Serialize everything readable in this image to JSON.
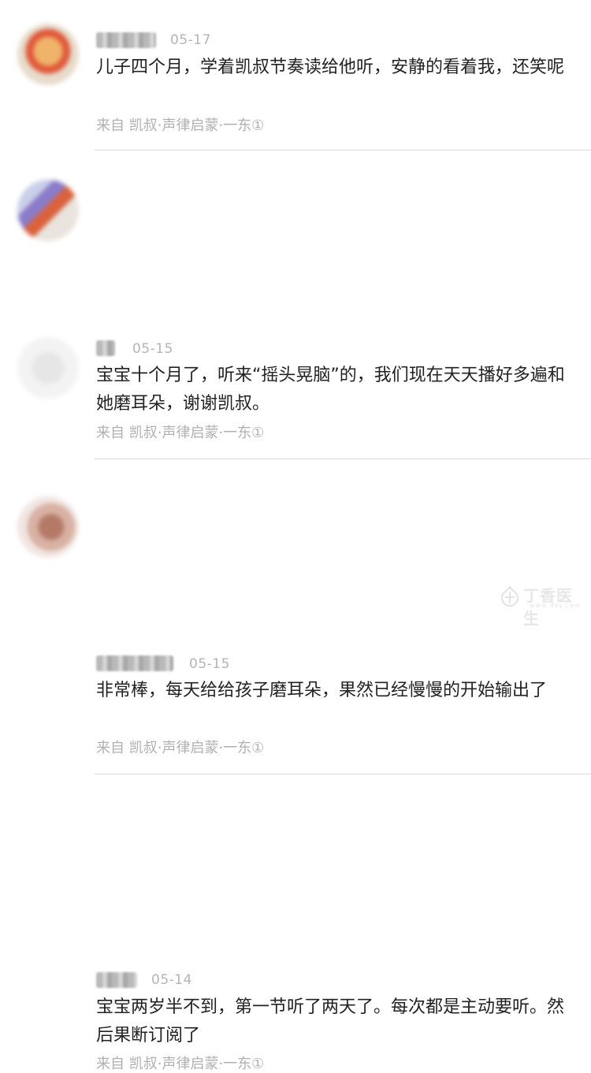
{
  "comments": [
    {
      "date": "05-17",
      "text": "儿子四个月，学着凯叔节奏读给他听，安静的看着我，还笑呢",
      "source": "来自 凯叔·声律启蒙·一东①"
    },
    {
      "date": "05-15",
      "text": "宝宝十个月了，听来“摇头晃脑”的，我们现在天天播好多遍和她磨耳朵，谢谢凯叔。",
      "source": "来自 凯叔·声律启蒙·一东①"
    },
    {
      "date": "05-15",
      "text": "非常棒，每天给给孩子磨耳朵，果然已经慢慢的开始输出了",
      "source": "来自 凯叔·声律启蒙·一东①"
    },
    {
      "date": "05-14",
      "text": "宝宝两岁半不到，第一节听了两天了。每次都是主动要听。然后果断订阅了",
      "source": "来自 凯叔·声律启蒙·一东①"
    }
  ],
  "watermark": {
    "name": "丁香医生",
    "url": "www.dxy.com",
    "icon": "dxy-logo-icon"
  },
  "colors": {
    "text": "#222222",
    "meta": "#b4b4b4",
    "divider": "#d8d8d8"
  }
}
